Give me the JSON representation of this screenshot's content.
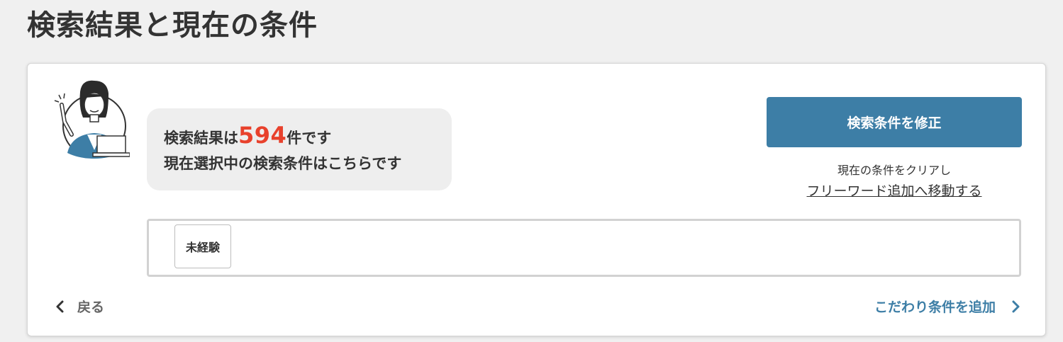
{
  "page": {
    "title": "検索結果と現在の条件"
  },
  "summary": {
    "prefix": "検索結果は",
    "count": "594",
    "suffix": "件です",
    "line2": "現在選択中の検索条件はこちらです"
  },
  "actions": {
    "edit_label": "検索条件を修正",
    "clear_note": "現在の条件をクリアし",
    "freeword_link": "フリーワード追加へ移動する"
  },
  "conditions": {
    "tags": [
      "未経験"
    ]
  },
  "footer": {
    "back_label": "戻る",
    "add_label": "こだわり条件を追加"
  },
  "colors": {
    "accent": "#3d7ea6",
    "count_red": "#e8412c",
    "background": "#f0f0f0"
  },
  "icons": {
    "back": "chevron-left-icon",
    "add": "chevron-right-icon",
    "avatar": "consultant-avatar"
  }
}
